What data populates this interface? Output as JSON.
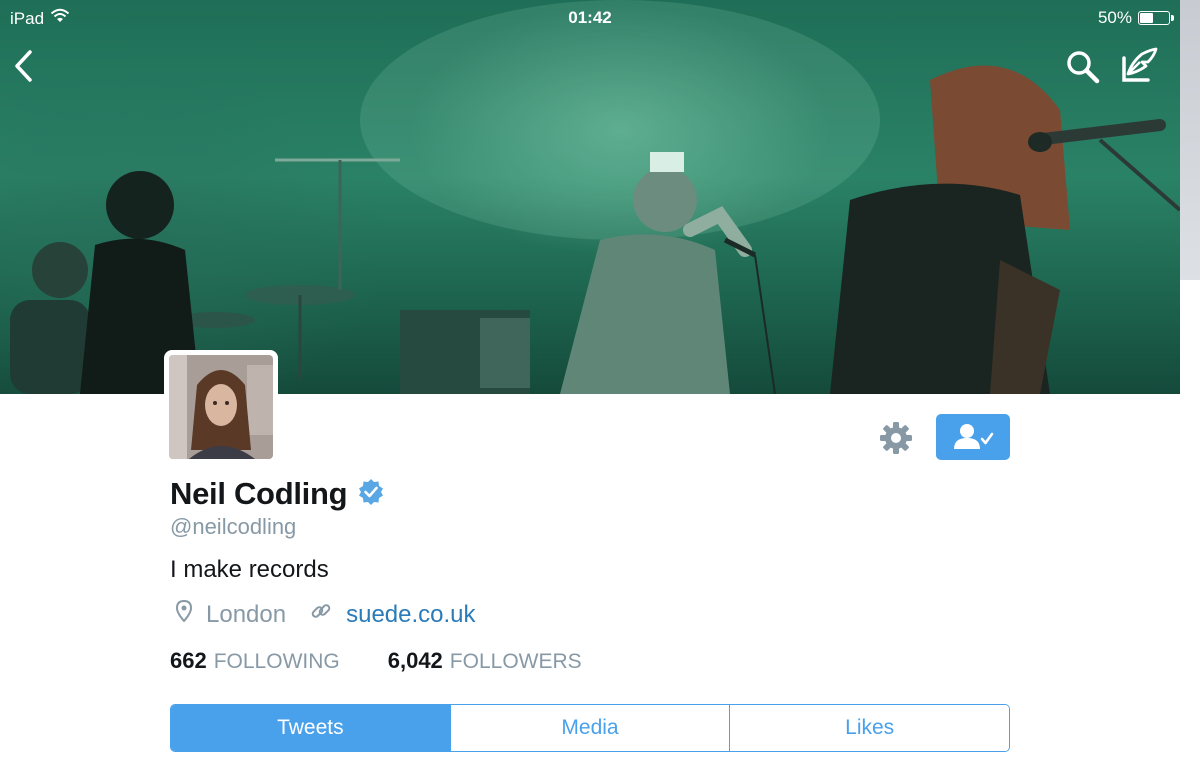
{
  "status_bar": {
    "device": "iPad",
    "time": "01:42",
    "battery_text": "50%",
    "battery_level": 0.5
  },
  "header": {
    "back_icon": "chevron-left-icon",
    "search_icon": "search-icon",
    "compose_icon": "compose-tweet-icon"
  },
  "profile": {
    "name": "Neil Codling",
    "verified": true,
    "handle": "@neilcodling",
    "bio": "I make records",
    "location": "London",
    "website": "suede.co.uk"
  },
  "stats": {
    "following_count": "662",
    "following_label": "FOLLOWING",
    "followers_count": "6,042",
    "followers_label": "FOLLOWERS"
  },
  "tabs": [
    {
      "label": "Tweets",
      "active": true
    },
    {
      "label": "Media",
      "active": false
    },
    {
      "label": "Likes",
      "active": false
    }
  ],
  "colors": {
    "accent": "#4aa1eb",
    "link": "#2b7bb9",
    "muted": "#8899a6",
    "verified": "#5aa7e6"
  }
}
